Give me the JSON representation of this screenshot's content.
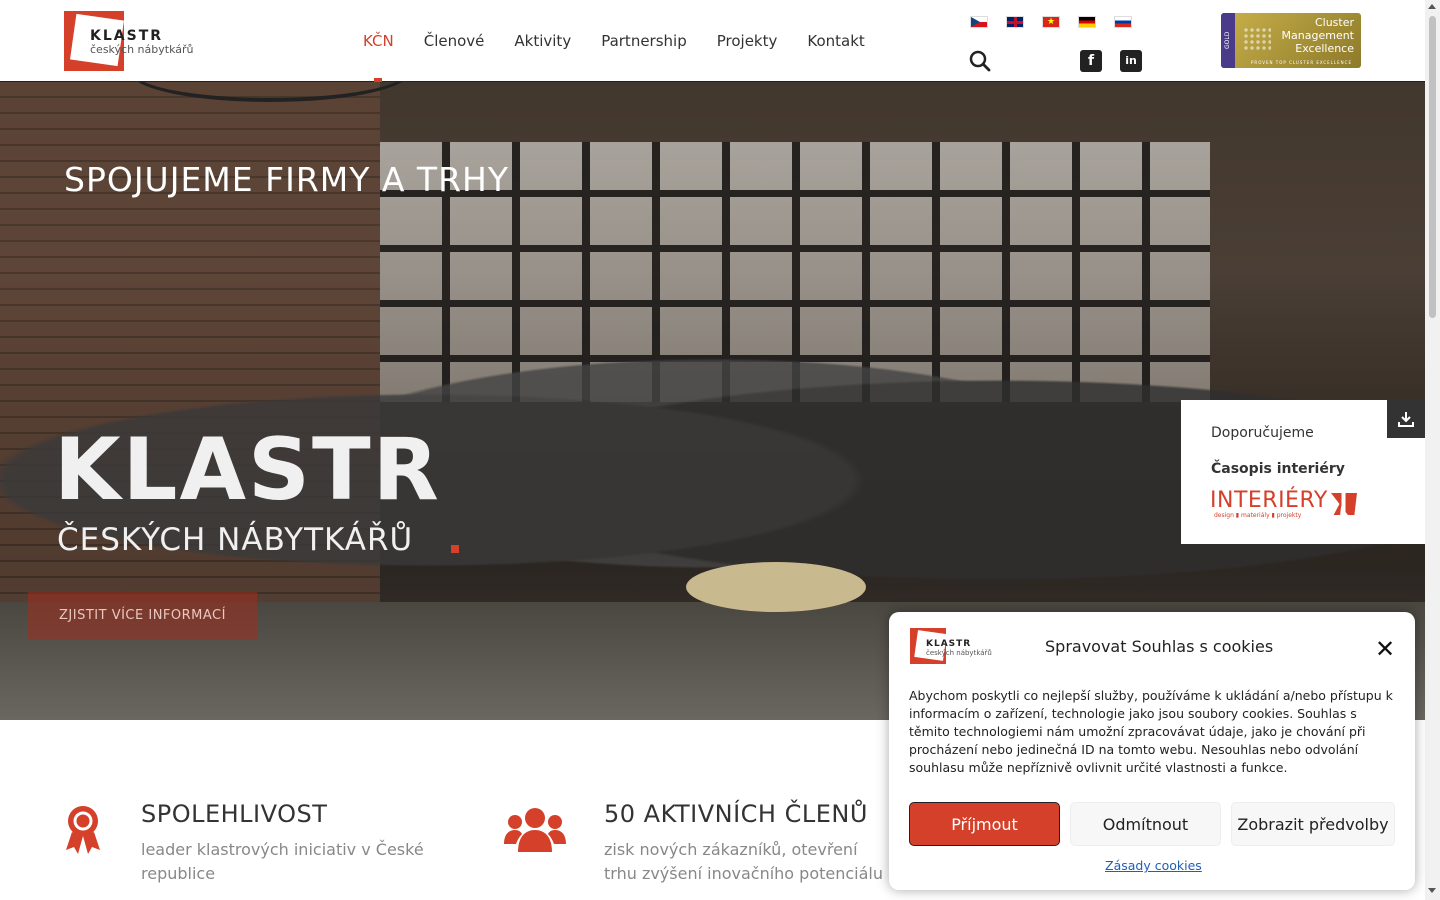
{
  "header": {
    "logo": {
      "line1": "KLASTR",
      "line2": "českých nábytkářů"
    },
    "nav": [
      "KČN",
      "Členové",
      "Aktivity",
      "Partnership",
      "Projekty",
      "Kontakt"
    ],
    "active_nav": "KČN",
    "languages": [
      "cs",
      "en",
      "vi",
      "de",
      "ru"
    ],
    "badge": {
      "tag": "GOLD",
      "title_lines": [
        "Cluster",
        "Management",
        "Excellence"
      ],
      "sub": "PROVEN TOP CLUSTER EXCELLENCE"
    }
  },
  "hero": {
    "tagline": "SPOJUJEME FIRMY A TRHY",
    "title": "KLASTR",
    "subtitle": "ČESKÝCH NÁBYTKÁŘŮ",
    "cta": "ZJISTIT VÍCE INFORMACÍ"
  },
  "recommend": {
    "label": "Doporučujeme",
    "magazine": "Časopis interiéry",
    "brand": "INTERIÉRY",
    "brand_sub": "design ▮ materiály ▮ projekty"
  },
  "features": [
    {
      "title": "SPOLEHLIVOST",
      "text": "leader klastrových iniciativ v České republice"
    },
    {
      "title": "50 AKTIVNÍCH ČLENŮ",
      "text": "zisk nových zákazníků, otevření trhu zvýšení inovačního potenciálu"
    }
  ],
  "cookie": {
    "logo_line1": "KLASTR",
    "logo_line2": "českých nábytkářů",
    "title": "Spravovat Souhlas s cookies",
    "text": "Abychom poskytli co nejlepší služby, používáme k ukládání a/nebo přístupu k informacím o zařízení, technologie jako jsou soubory cookies. Souhlas s těmito technologiemi nám umožní zpracovávat údaje, jako je chování při procházení nebo jedinečná ID na tomto webu. Nesouhlas nebo odvolání souhlasu může nepříznivě ovlivnit určité vlastnosti a funkce.",
    "accept": "Příjmout",
    "deny": "Odmítnout",
    "prefs": "Zobrazit předvolby",
    "policy": "Zásady cookies"
  },
  "colors": {
    "accent": "#d4402a",
    "text": "#333333"
  }
}
